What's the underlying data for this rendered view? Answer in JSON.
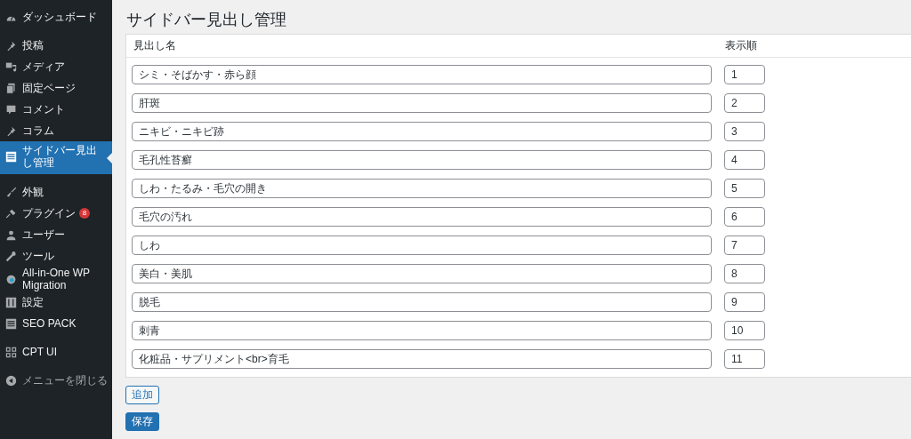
{
  "sidebar": {
    "groups": [
      [
        {
          "label": "ダッシュボード",
          "selected": false
        }
      ],
      [
        {
          "label": "投稿",
          "selected": false
        },
        {
          "label": "メディア",
          "selected": false
        },
        {
          "label": "固定ページ",
          "selected": false
        },
        {
          "label": "コメント",
          "selected": false
        },
        {
          "label": "コラム",
          "selected": false
        },
        {
          "label": "サイドバー見出し管理",
          "selected": true
        }
      ],
      [
        {
          "label": "外観",
          "selected": false
        },
        {
          "label": "プラグイン",
          "selected": false,
          "badge": "8"
        },
        {
          "label": "ユーザー",
          "selected": false
        },
        {
          "label": "ツール",
          "selected": false
        },
        {
          "label": "All-in-One WP Migration",
          "selected": false
        },
        {
          "label": "設定",
          "selected": false
        },
        {
          "label": "SEO PACK",
          "selected": false
        }
      ],
      [
        {
          "label": "CPT UI",
          "selected": false
        }
      ]
    ],
    "collapse_label": "メニューを閉じる"
  },
  "page": {
    "title": "サイドバー見出し管理"
  },
  "table": {
    "columns": [
      "見出し名",
      "表示順"
    ],
    "rows": [
      {
        "name": "シミ・そばかす・赤ら顔",
        "order": "1"
      },
      {
        "name": "肝斑",
        "order": "2"
      },
      {
        "name": "ニキビ・ニキビ跡",
        "order": "3"
      },
      {
        "name": "毛孔性苔癬",
        "order": "4"
      },
      {
        "name": "しわ・たるみ・毛穴の開き",
        "order": "5"
      },
      {
        "name": "毛穴の汚れ",
        "order": "6"
      },
      {
        "name": "しわ",
        "order": "7"
      },
      {
        "name": "美白・美肌",
        "order": "8"
      },
      {
        "name": "脱毛",
        "order": "9"
      },
      {
        "name": "刺青",
        "order": "10"
      },
      {
        "name": "化粧品・サプリメント<br>育毛",
        "order": "11"
      }
    ]
  },
  "buttons": {
    "add": "追加",
    "save": "保存"
  }
}
